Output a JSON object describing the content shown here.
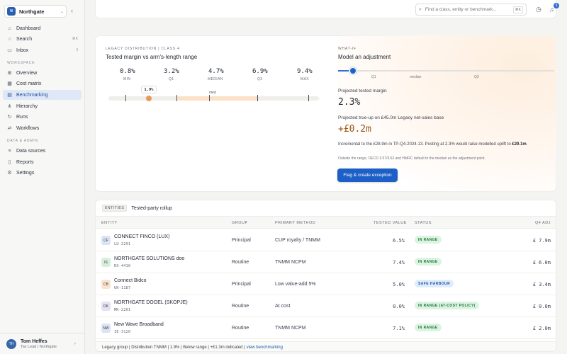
{
  "app": {
    "workspace_name": "Northgate",
    "workspace_initials": "N"
  },
  "sidebar": {
    "primary": [
      {
        "label": "Dashboard",
        "icon": "home-icon"
      },
      {
        "label": "Search",
        "icon": "search-icon",
        "shortcut": "⌘K"
      },
      {
        "label": "Inbox",
        "icon": "inbox-icon",
        "count": "3"
      }
    ],
    "section_workspace": "WORKSPACE",
    "workspace_items": [
      {
        "label": "Overview",
        "icon": "grid-icon"
      },
      {
        "label": "Cost matrix",
        "icon": "table-icon"
      },
      {
        "label": "Benchmarking",
        "icon": "chart-icon",
        "active": true
      },
      {
        "label": "Hierarchy",
        "icon": "hierarchy-icon"
      },
      {
        "label": "Runs",
        "icon": "runs-icon"
      },
      {
        "label": "Workflows",
        "icon": "workflow-icon"
      }
    ],
    "section_data": "DATA & ADMIN",
    "data_items": [
      {
        "label": "Data sources",
        "icon": "database-icon"
      },
      {
        "label": "Reports",
        "icon": "report-icon"
      },
      {
        "label": "Settings",
        "icon": "gear-icon"
      }
    ],
    "user": {
      "name": "Tom Heffes",
      "role": "Tax Lead | Northgate",
      "initials": "TH"
    }
  },
  "topbar": {
    "search_placeholder": "Find a class, entity or benchmark...",
    "search_shortcut": "⌘K",
    "notification_count": "3"
  },
  "distribution": {
    "eyebrow": "LEGACY DISTRIBUTION | CLASS 4",
    "title": "Tested margin vs arm's-length range",
    "stats": [
      {
        "value": "0.8%",
        "label": "MIN"
      },
      {
        "value": "3.2%",
        "label": "Q1"
      },
      {
        "value": "4.7%",
        "label": "MEDIAN"
      },
      {
        "value": "6.9%",
        "label": "Q3"
      },
      {
        "value": "9.4%",
        "label": "MAX"
      }
    ],
    "median_label": "med",
    "tested_value": "1.9%",
    "tested_value_num": 1.9,
    "range_min": 0.8,
    "range_max": 9.4
  },
  "whatif": {
    "eyebrow": "WHAT-IF",
    "title": "Model an adjustment",
    "slider_labels": [
      "Q1",
      "median",
      "Q3"
    ],
    "projected_margin_label": "Projected tested margin",
    "projected_margin_value": "2.3%",
    "trueup_label": "Projected true-up on £45.0m Legacy net-sales base",
    "trueup_value": "+£0.2m",
    "incremental_prefix": "Incremental to the £28.9m in TP-Q4-2024-13. Posting at 2.3% would raise modelled uplift to ",
    "incremental_bold": "£29.1m",
    "incremental_suffix": ".",
    "fine_print": "Outside the range, OECD 3.57/3.62 and HMRC default to the median as the adjustment point.",
    "button_label": "Flag & create exception"
  },
  "rollup": {
    "tag": "ENTITIES",
    "title": "Tested-party rollup",
    "columns": [
      "ENTITY",
      "GROUP",
      "PRIMARY METHOD",
      "TESTED VALUE",
      "STATUS",
      "Q4 ADJ"
    ],
    "rows": [
      {
        "initials": "CF",
        "name": "CONNECT FINCO (LUX)",
        "code": "LU-2291",
        "group": "Principal",
        "method": "CUP royalty / TNMM",
        "tested": "6.5%",
        "status": "IN RANGE",
        "status_kind": "green",
        "adj": "£ 7.9m",
        "avatar_color": "#dbe4f3"
      },
      {
        "initials": "IS",
        "name": "NORTHGATE SOLUTIONS doo",
        "code": "RS-4410",
        "group": "Routine",
        "method": "TNMM NCPM",
        "tested": "7.4%",
        "status": "IN RANGE",
        "status_kind": "green",
        "adj": "£ 6.0m",
        "avatar_color": "#d8eedd"
      },
      {
        "initials": "CB",
        "name": "Connect Bidco",
        "code": "UK-1187",
        "group": "Principal",
        "method": "Low value-add 5%",
        "tested": "5.0%",
        "status": "SAFE HARBOUR",
        "status_kind": "blue",
        "adj": "£ 3.4m",
        "avatar_color": "#fbe3cf"
      },
      {
        "initials": "DK",
        "name": "NORTHGATE DOOEL (SKOPJE)",
        "code": "MK-2201",
        "group": "Routine",
        "method": "At cost",
        "tested": "0.0%",
        "status": "IN RANGE (AT-COST POLICY)",
        "status_kind": "green",
        "adj": "£ 0.0m",
        "avatar_color": "#e4e1f2"
      },
      {
        "initials": "NW",
        "name": "New Wave Broadband",
        "code": "IE-3120",
        "group": "Routine",
        "method": "TNMM NCPM",
        "tested": "7.1%",
        "status": "IN RANGE",
        "status_kind": "green",
        "adj": "£ 2.0m",
        "avatar_color": "#dbe4f3"
      }
    ],
    "footer_text": "Legacy group | Distribution TNMM | 1.9% | Below range | +£1.3m indicated |",
    "footer_link": "view benchmarking"
  },
  "colors": {
    "accent": "#1c5fc6",
    "amber": "#9a5410",
    "range_fill": "#fbe1c8",
    "in_range": "#1e7a3a"
  }
}
